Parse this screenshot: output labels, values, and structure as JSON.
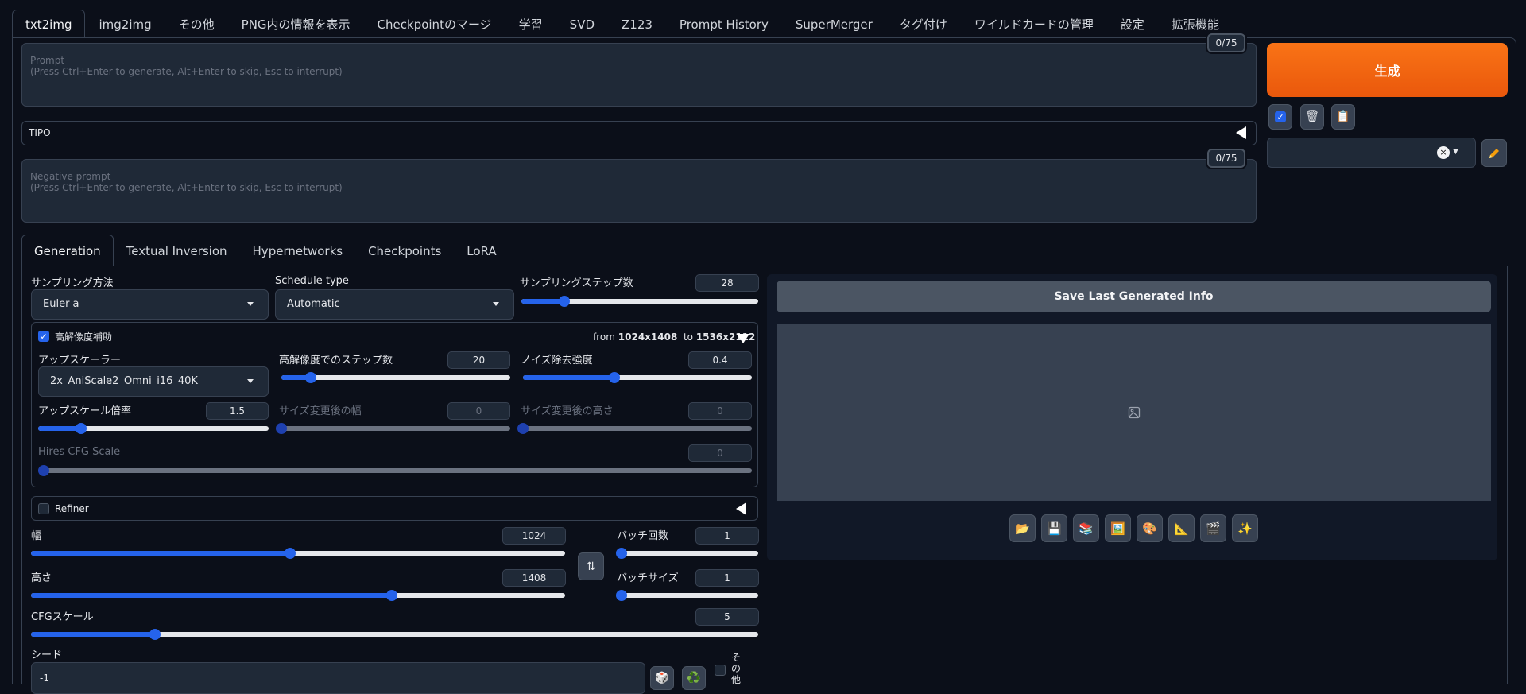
{
  "top_tabs": [
    "txt2img",
    "img2img",
    "その他",
    "PNG内の情報を表示",
    "Checkpointのマージ",
    "学習",
    "SVD",
    "Z123",
    "Prompt History",
    "SuperMerger",
    "タグ付け",
    "ワイルドカードの管理",
    "設定",
    "拡張機能"
  ],
  "prompt": {
    "label": "Prompt",
    "hint": "(Press Ctrl+Enter to generate, Alt+Enter to skip, Esc to interrupt)",
    "token_count": "0/75"
  },
  "tipo": {
    "label": "TIPO"
  },
  "negative_prompt": {
    "label": "Negative prompt",
    "hint": "(Press Ctrl+Enter to generate, Alt+Enter to skip, Esc to interrupt)",
    "token_count": "0/75"
  },
  "generate": {
    "label": "生成"
  },
  "sub_tabs": [
    "Generation",
    "Textual Inversion",
    "Hypernetworks",
    "Checkpoints",
    "LoRA"
  ],
  "sampling": {
    "method_label": "サンプリング方法",
    "method_value": "Euler a",
    "schedule_label": "Schedule type",
    "schedule_value": "Automatic",
    "steps_label": "サンプリングステップ数",
    "steps_value": "28",
    "steps_fraction": 0.18
  },
  "hires": {
    "label": "高解像度補助",
    "from_word": "from",
    "from_res": "1024x1408",
    "to_word": "to",
    "to_res": "1536x2112",
    "upscaler_label": "アップスケーラー",
    "upscaler_value": "2x_AniScale2_Omni_i16_40K",
    "steps_label": "高解像度でのステップ数",
    "steps_value": "20",
    "steps_fraction": 0.13,
    "denoise_label": "ノイズ除去強度",
    "denoise_value": "0.4",
    "denoise_fraction": 0.4,
    "scale_label": "アップスケール倍率",
    "scale_value": "1.5",
    "scale_fraction": 0.185,
    "resize_w_label": "サイズ変更後の幅",
    "resize_w_value": "0",
    "resize_h_label": "サイズ変更後の高さ",
    "resize_h_value": "0",
    "cfg_label": "Hires CFG Scale",
    "cfg_value": "0"
  },
  "refiner": {
    "label": "Refiner"
  },
  "size": {
    "width_label": "幅",
    "width_value": "1024",
    "width_fraction": 0.485,
    "height_label": "高さ",
    "height_value": "1408",
    "height_fraction": 0.675
  },
  "batch": {
    "count_label": "バッチ回数",
    "count_value": "1",
    "size_label": "バッチサイズ",
    "size_value": "1"
  },
  "cfg": {
    "label": "CFGスケール",
    "value": "5",
    "fraction": 0.17
  },
  "seed": {
    "label": "シード",
    "value": "-1",
    "extra_label": "その他"
  },
  "output": {
    "save_label": "Save Last Generated Info"
  },
  "icons": {
    "open_folder": "📂",
    "save": "💾",
    "zip": "📚",
    "send_img2img": "🖼️",
    "send_inpaint": "🎨",
    "send_extras": "📐",
    "send_video": "🎬",
    "enhance": "✨",
    "trash": "🗑",
    "clipboard": "📋",
    "dice": "🎲",
    "recycle": "♻️"
  },
  "colors": {
    "accent": "#2563eb",
    "generate": "#f97316",
    "background": "#0b0f19"
  }
}
